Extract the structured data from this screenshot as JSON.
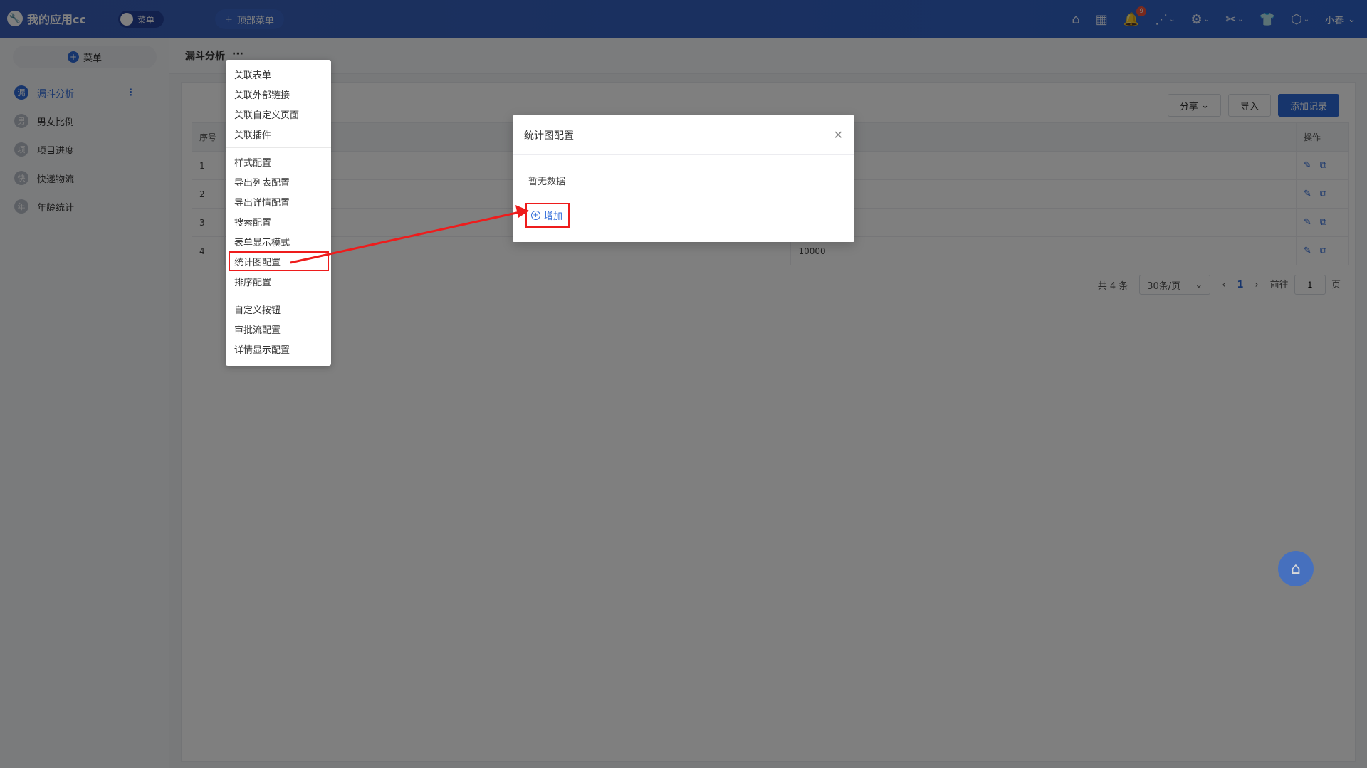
{
  "app": {
    "title": "我的应用cc",
    "toggle_label": "菜单",
    "top_menu_label": "顶部菜单",
    "notification_count": "9",
    "user_name": "小春"
  },
  "sidebar": {
    "add_menu_label": "菜单",
    "items": [
      {
        "avatar": "漏",
        "label": "漏斗分析",
        "active": true
      },
      {
        "avatar": "男",
        "label": "男女比例"
      },
      {
        "avatar": "项",
        "label": "项目进度"
      },
      {
        "avatar": "快",
        "label": "快递物流"
      },
      {
        "avatar": "年",
        "label": "年龄统计"
      }
    ]
  },
  "crumb": {
    "title": "漏斗分析",
    "more": "···"
  },
  "toolbar": {
    "share": "分享",
    "import": "导入",
    "add_record": "添加记录"
  },
  "table": {
    "headers": {
      "index": "序号",
      "ops": "操作"
    },
    "rows": [
      {
        "index": "1",
        "value": ""
      },
      {
        "index": "2",
        "value": ""
      },
      {
        "index": "3",
        "value": ""
      },
      {
        "index": "4",
        "value": "10000"
      }
    ]
  },
  "pager": {
    "total": "共 4 条",
    "size": "30条/页",
    "current": "1",
    "goto_prefix": "前往",
    "goto_value": "1",
    "goto_suffix": "页"
  },
  "dropdown": {
    "group1": [
      "关联表单",
      "关联外部链接",
      "关联自定义页面",
      "关联插件"
    ],
    "group2": [
      "样式配置",
      "导出列表配置",
      "导出详情配置",
      "搜索配置",
      "表单显示模式",
      "统计图配置",
      "排序配置"
    ],
    "group3": [
      "自定义按钮",
      "审批流配置",
      "详情显示配置"
    ]
  },
  "modal": {
    "title": "统计图配置",
    "empty_text": "暂无数据",
    "add_label": "增加"
  },
  "colors": {
    "primary": "#2f6bd9",
    "highlight": "#ee1c1c",
    "topbar": "#3a5fb8"
  }
}
